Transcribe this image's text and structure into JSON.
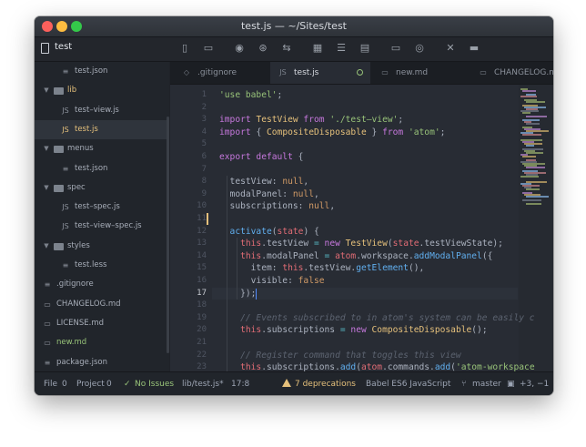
{
  "window": {
    "title": "test.js — ~/Sites/test"
  },
  "toolbar": {
    "project_label": "test",
    "icons": [
      "document-icon",
      "folder-icon",
      "github-icon",
      "git-icon",
      "git-branch-icon",
      "keyboard-icon",
      "list-icon",
      "clipboard-icon",
      "panel-icon",
      "eye-icon",
      "tools-icon",
      "terminal-icon"
    ]
  },
  "tree": {
    "items": [
      {
        "label": "test.json",
        "indent": 2,
        "icon": "file",
        "kind": "file"
      },
      {
        "label": "lib",
        "indent": 1,
        "icon": "folder",
        "kind": "folder",
        "style": "yellow"
      },
      {
        "label": "test–view.js",
        "indent": 2,
        "icon": "js",
        "kind": "file"
      },
      {
        "label": "test.js",
        "indent": 2,
        "icon": "js",
        "kind": "file",
        "style": "yellow",
        "active": true
      },
      {
        "label": "menus",
        "indent": 1,
        "icon": "folder",
        "kind": "folder"
      },
      {
        "label": "test.json",
        "indent": 2,
        "icon": "file",
        "kind": "file"
      },
      {
        "label": "spec",
        "indent": 1,
        "icon": "folder",
        "kind": "folder"
      },
      {
        "label": "test–spec.js",
        "indent": 2,
        "icon": "js",
        "kind": "file"
      },
      {
        "label": "test–view–spec.js",
        "indent": 2,
        "icon": "js",
        "kind": "file"
      },
      {
        "label": "styles",
        "indent": 1,
        "icon": "folder",
        "kind": "folder"
      },
      {
        "label": "test.less",
        "indent": 2,
        "icon": "file",
        "kind": "file"
      },
      {
        "label": ".gitignore",
        "indent": 1,
        "icon": "file",
        "kind": "file"
      },
      {
        "label": "CHANGELOG.md",
        "indent": 1,
        "icon": "md",
        "kind": "file"
      },
      {
        "label": "LICENSE.md",
        "indent": 1,
        "icon": "md",
        "kind": "file"
      },
      {
        "label": "new.md",
        "indent": 1,
        "icon": "md",
        "kind": "file",
        "style": "green"
      },
      {
        "label": "package.json",
        "indent": 1,
        "icon": "file",
        "kind": "file"
      }
    ]
  },
  "tabs": [
    {
      "label": ".gitignore",
      "icon": "file",
      "active": false
    },
    {
      "label": "test.js",
      "icon": "JS",
      "active": true,
      "modified": true
    },
    {
      "label": "new.md",
      "icon": "md",
      "active": false
    },
    {
      "label": "CHANGELOG.md",
      "icon": "md",
      "active": false
    }
  ],
  "editor": {
    "cursor_line": 17,
    "modified_line": 11,
    "lines": [
      {
        "n": "1",
        "tokens": [
          [
            "s",
            "'use babel'"
          ],
          [
            "",
            "; "
          ]
        ]
      },
      {
        "n": "2",
        "tokens": []
      },
      {
        "n": "3",
        "tokens": [
          [
            "k",
            "import "
          ],
          [
            "cl",
            "TestView"
          ],
          [
            "k",
            " from "
          ],
          [
            "s",
            "'./test–view'"
          ],
          [
            "",
            ";"
          ]
        ]
      },
      {
        "n": "4",
        "tokens": [
          [
            "k",
            "import "
          ],
          [
            "",
            "{ "
          ],
          [
            "cl",
            "CompositeDisposable"
          ],
          [
            "",
            " } "
          ],
          [
            "k",
            "from "
          ],
          [
            "s",
            "'atom'"
          ],
          [
            "",
            ";"
          ]
        ]
      },
      {
        "n": "5",
        "tokens": []
      },
      {
        "n": "6",
        "tokens": [
          [
            "k",
            "export default "
          ],
          [
            "",
            "{"
          ]
        ]
      },
      {
        "n": "7",
        "tokens": []
      },
      {
        "n": "8",
        "tokens": [
          [
            "",
            "  testView: "
          ],
          [
            "n",
            "null"
          ],
          [
            "",
            ","
          ]
        ]
      },
      {
        "n": "9",
        "tokens": [
          [
            "",
            "  modalPanel: "
          ],
          [
            "n",
            "null"
          ],
          [
            "",
            ","
          ]
        ]
      },
      {
        "n": "10",
        "tokens": [
          [
            "",
            "  subscriptions: "
          ],
          [
            "n",
            "null"
          ],
          [
            "",
            ","
          ]
        ]
      },
      {
        "n": "11",
        "tokens": []
      },
      {
        "n": "12",
        "tokens": [
          [
            "f",
            "  activate"
          ],
          [
            "",
            "("
          ],
          [
            "p",
            "state"
          ],
          [
            "",
            ") {"
          ]
        ]
      },
      {
        "n": "13",
        "tokens": [
          [
            "p",
            "    this"
          ],
          [
            "",
            ".testView "
          ],
          [
            "o",
            "="
          ],
          [
            "k",
            " new "
          ],
          [
            "cl",
            "TestView"
          ],
          [
            "",
            "("
          ],
          [
            "p",
            "state"
          ],
          [
            "",
            ".testViewState);"
          ]
        ]
      },
      {
        "n": "14",
        "tokens": [
          [
            "p",
            "    this"
          ],
          [
            "",
            ".modalPanel "
          ],
          [
            "o",
            "="
          ],
          [
            "p",
            " atom"
          ],
          [
            "",
            ".workspace."
          ],
          [
            "f",
            "addModalPanel"
          ],
          [
            "",
            "({"
          ]
        ]
      },
      {
        "n": "15",
        "tokens": [
          [
            "",
            "      item: "
          ],
          [
            "p",
            "this"
          ],
          [
            "",
            ".testView."
          ],
          [
            "f",
            "getElement"
          ],
          [
            "",
            "(),"
          ]
        ]
      },
      {
        "n": "16",
        "tokens": [
          [
            "",
            "      visible: "
          ],
          [
            "n",
            "false"
          ]
        ]
      },
      {
        "n": "17",
        "tokens": [
          [
            "",
            "    });"
          ]
        ]
      },
      {
        "n": "18",
        "tokens": []
      },
      {
        "n": "19",
        "tokens": [
          [
            "c",
            "    // Events subscribed to in atom's system can be easily c"
          ]
        ]
      },
      {
        "n": "20",
        "tokens": [
          [
            "p",
            "    this"
          ],
          [
            "",
            ".subscriptions "
          ],
          [
            "o",
            "="
          ],
          [
            "k",
            " new "
          ],
          [
            "cl",
            "CompositeDisposable"
          ],
          [
            "",
            "();"
          ]
        ]
      },
      {
        "n": "21",
        "tokens": []
      },
      {
        "n": "22",
        "tokens": [
          [
            "c",
            "    // Register command that toggles this view"
          ]
        ]
      },
      {
        "n": "23",
        "tokens": [
          [
            "p",
            "    this"
          ],
          [
            "",
            ".subscriptions."
          ],
          [
            "f",
            "add"
          ],
          [
            "",
            "("
          ],
          [
            "p",
            "atom"
          ],
          [
            "",
            ".commands."
          ],
          [
            "f",
            "add"
          ],
          [
            "",
            "("
          ],
          [
            "s",
            "'atom-workspace"
          ]
        ]
      }
    ]
  },
  "status": {
    "file": "File",
    "file_count": "0",
    "project": "Project",
    "project_count": "0",
    "no_issues": "No Issues",
    "path": "lib/test.js*",
    "position": "17:8",
    "deprecations": "7 deprecations",
    "grammar": "Babel ES6 JavaScript",
    "branch": "master",
    "diff": "+3, −1"
  }
}
